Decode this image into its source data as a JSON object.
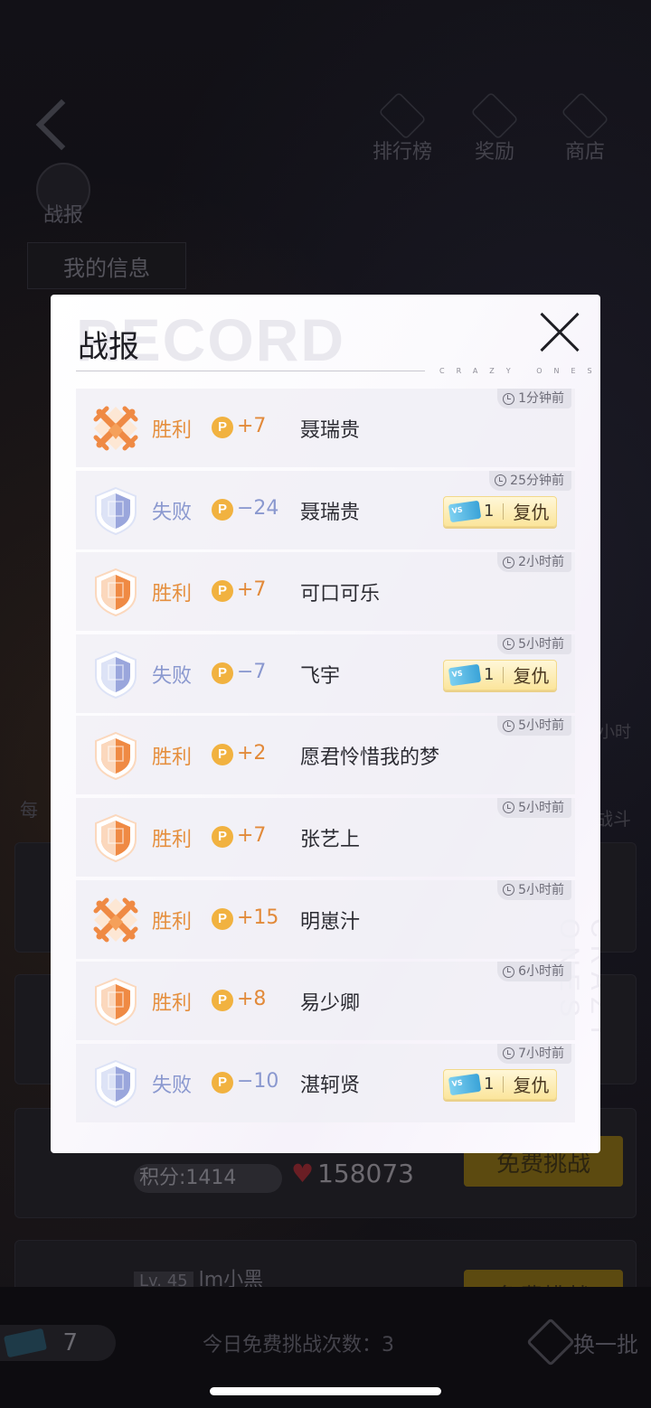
{
  "background": {
    "nav": {
      "ranking_label": "排行榜",
      "reward_label": "奖励",
      "shop_label": "商店"
    },
    "record_entry_label": "战报",
    "my_info_tab": "我的信息",
    "daily_label_partial": "每",
    "fight_label_partial": "战斗",
    "hour_label_partial": "小时",
    "score_label": "积分:1414",
    "hearts_value": "158073",
    "level_tag": "Lv. 45",
    "player_name": "lm小黑",
    "challenge_button_1": "免费挑战",
    "challenge_button_2": "免费挑战",
    "ticket_count": "7",
    "free_count_text": "今日免费挑战次数：3",
    "refresh_label": "换一批"
  },
  "modal": {
    "title": "战报",
    "watermark": "RECORD",
    "brand": "CRAZY ONES",
    "side_watermark": "CRAZY ONES"
  },
  "records": [
    {
      "time": "1分钟前",
      "result": "胜利",
      "outcome": "win",
      "badge": "crossed-swords",
      "points": "+7",
      "opponent": "聂瑞贵",
      "revenge": false
    },
    {
      "time": "25分钟前",
      "result": "失败",
      "outcome": "lose",
      "badge": "shield",
      "points": "−24",
      "opponent": "聂瑞贵",
      "revenge": true,
      "tickets": "1",
      "revenge_label": "复仇"
    },
    {
      "time": "2小时前",
      "result": "胜利",
      "outcome": "win",
      "badge": "shield",
      "points": "+7",
      "opponent": "可口可乐",
      "revenge": false
    },
    {
      "time": "5小时前",
      "result": "失败",
      "outcome": "lose",
      "badge": "shield",
      "points": "−7",
      "opponent": "飞宇",
      "revenge": true,
      "tickets": "1",
      "revenge_label": "复仇"
    },
    {
      "time": "5小时前",
      "result": "胜利",
      "outcome": "win",
      "badge": "shield",
      "points": "+2",
      "opponent": "愿君怜惜我的梦",
      "revenge": false
    },
    {
      "time": "5小时前",
      "result": "胜利",
      "outcome": "win",
      "badge": "shield",
      "points": "+7",
      "opponent": "张艺上",
      "revenge": false
    },
    {
      "time": "5小时前",
      "result": "胜利",
      "outcome": "win",
      "badge": "crossed-swords",
      "points": "+15",
      "opponent": "明崽汁",
      "revenge": false
    },
    {
      "time": "6小时前",
      "result": "胜利",
      "outcome": "win",
      "badge": "shield",
      "points": "+8",
      "opponent": "易少卿",
      "revenge": false
    },
    {
      "time": "7小时前",
      "result": "失败",
      "outcome": "lose",
      "badge": "shield",
      "points": "−10",
      "opponent": "湛轲贤",
      "revenge": true,
      "tickets": "1",
      "revenge_label": "复仇"
    }
  ],
  "points_glyph": "P",
  "colors": {
    "win": "#e58f3e",
    "lose": "#8a98cf",
    "revenge_button": "#fbe59c",
    "points_coin": "#f1b240"
  }
}
